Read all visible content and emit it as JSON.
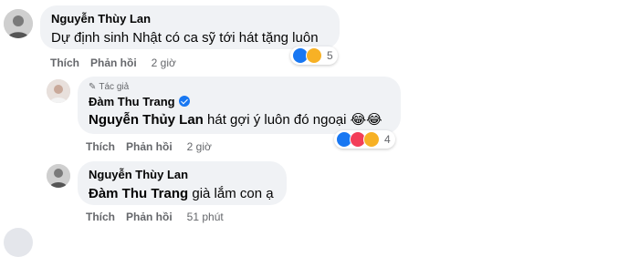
{
  "comments": [
    {
      "author": "Nguyễn Thùy Lan",
      "text": "Dự định sinh Nhật có ca sỹ tới hát tặng luôn",
      "actions": {
        "like": "Thích",
        "reply": "Phản hồi",
        "time": "2 giờ"
      },
      "reaction_count": "5",
      "reaction_icons": [
        "like-icon",
        "haha-icon"
      ]
    },
    {
      "badge": "Tác giả",
      "author": "Đàm Thu Trang",
      "mention": "Nguyễn Thủy Lan",
      "text": " hát gợi ý luôn đó ngoại 😂😂",
      "actions": {
        "like": "Thích",
        "reply": "Phản hồi",
        "time": "2 giờ"
      },
      "reaction_count": "4",
      "reaction_icons": [
        "like-icon",
        "love-icon",
        "haha-icon"
      ]
    },
    {
      "author": "Nguyễn Thùy Lan",
      "mention": "Đàm Thu Trang",
      "text": " già lắm con ạ",
      "actions": {
        "like": "Thích",
        "reply": "Phản hồi",
        "time": "51 phút"
      }
    }
  ],
  "colors": {
    "bubble": "#f0f2f5",
    "meta": "#65676b",
    "like": "#1877f2",
    "love": "#f33e58",
    "haha": "#f7b125",
    "verified": "#1877f2"
  }
}
